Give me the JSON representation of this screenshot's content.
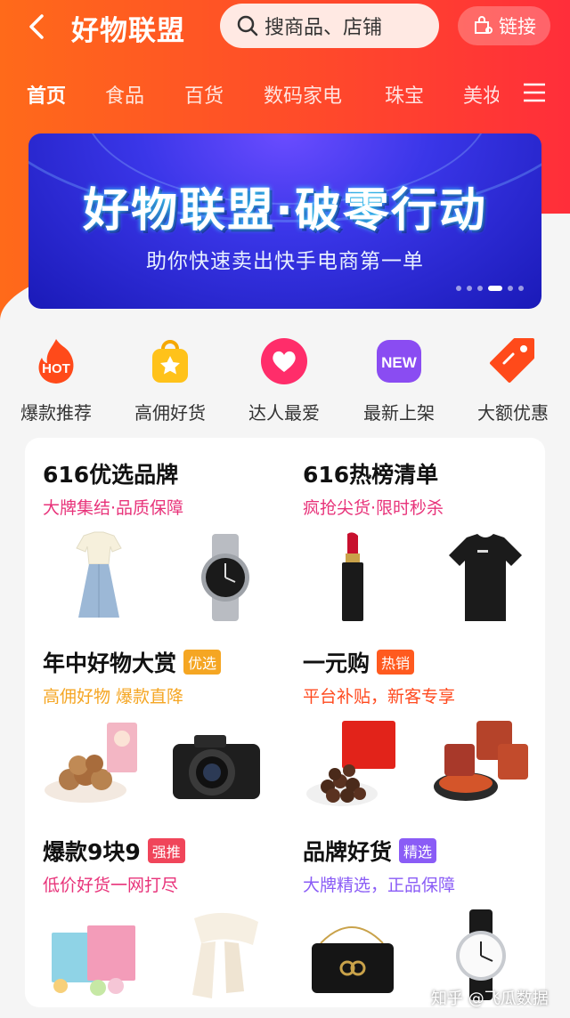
{
  "header": {
    "title": "好物联盟",
    "search_placeholder": "搜商品、店铺",
    "link_label": "链接"
  },
  "categories": [
    "首页",
    "食品",
    "百货",
    "数码家电",
    "珠宝",
    "美妆"
  ],
  "banner": {
    "title": "好物联盟·破零行动",
    "subtitle": "助你快速卖出快手电商第一单",
    "active_dot": 4,
    "dot_count": 6
  },
  "quick_links": [
    {
      "label": "爆款推荐",
      "icon": "hot-flame-icon",
      "badge": "HOT"
    },
    {
      "label": "高佣好货",
      "icon": "star-bag-icon"
    },
    {
      "label": "达人最爱",
      "icon": "heart-icon"
    },
    {
      "label": "最新上架",
      "icon": "new-badge-icon",
      "badge": "NEW"
    },
    {
      "label": "大额优惠",
      "icon": "price-tag-icon"
    }
  ],
  "sections": [
    {
      "title": "616优选品牌",
      "tag": "",
      "subtitle": "大牌集结·品质保障",
      "sub_color": "#e8337a",
      "products": [
        "dress",
        "watch"
      ]
    },
    {
      "title": "616热榜清单",
      "tag": "",
      "subtitle": "疯抢尖货·限时秒杀",
      "sub_color": "#e8337a",
      "products": [
        "lipstick",
        "tshirt"
      ]
    },
    {
      "title": "年中好物大赏",
      "tag": "优选",
      "tag_color": "#f5a623",
      "subtitle": "高佣好物 爆款直降",
      "sub_color": "#f5a623",
      "products": [
        "pecans",
        "camera"
      ]
    },
    {
      "title": "一元购",
      "tag": "热销",
      "tag_color": "#ff5a1f",
      "subtitle": "平台补贴，新客专享",
      "sub_color": "#ff4a1f",
      "products": [
        "chocolate",
        "noodles"
      ]
    },
    {
      "title": "爆款9块9",
      "tag": "强推",
      "tag_color": "#f0455a",
      "subtitle": "低价好货一网打尽",
      "sub_color": "#e8337a",
      "products": [
        "macaron",
        "scarf"
      ]
    },
    {
      "title": "品牌好货",
      "tag": "精选",
      "tag_color": "#8a5cf6",
      "subtitle": "大牌精选，正品保障",
      "sub_color": "#8a5cf6",
      "products": [
        "handbag",
        "dress-watch"
      ]
    }
  ],
  "watermark": "知乎 @飞瓜数据"
}
